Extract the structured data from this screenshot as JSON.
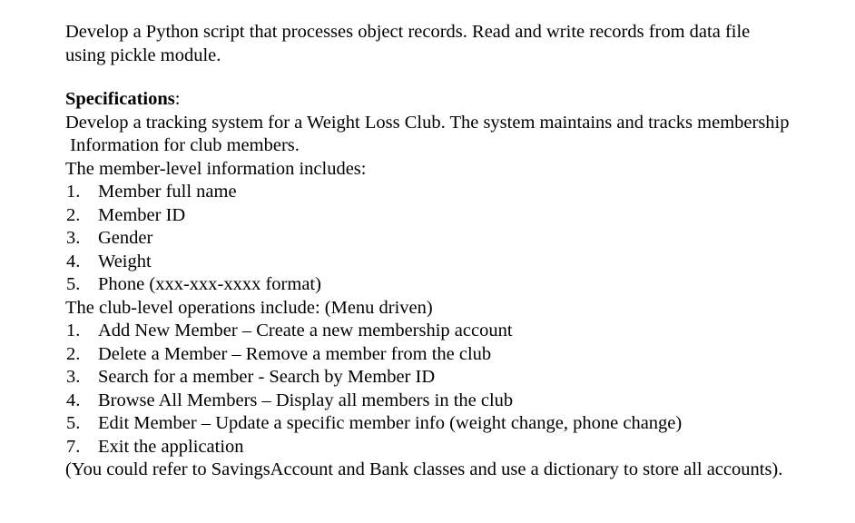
{
  "document": {
    "intro": {
      "text": "Develop a Python script that processes object records. Read and write records from data file using pickle module."
    },
    "specifications": {
      "heading": "Specifications",
      "heading_colon": ":",
      "overview_line1": "Develop a tracking system for a Weight Loss Club. The system maintains and tracks membership",
      "overview_line2": " Information for club members.",
      "member_level_header": "The member-level information includes:",
      "member_level_items": [
        {
          "number": "1.",
          "text": "Member full name"
        },
        {
          "number": "2.",
          "text": "Member ID"
        },
        {
          "number": "3.",
          "text": "Gender"
        },
        {
          "number": "4.",
          "text": "Weight"
        },
        {
          "number": "5.",
          "text": "Phone (xxx-xxx-xxxx format)"
        }
      ],
      "club_level_header": "The club-level operations include: (Menu driven)",
      "club_level_items": [
        {
          "number": "1.",
          "text": "Add New Member – Create a new membership account"
        },
        {
          "number": "2.",
          "text": "Delete a Member – Remove a member from the club"
        },
        {
          "number": "3.",
          "text": "Search for a member - Search by Member ID"
        },
        {
          "number": "4.",
          "text": "Browse All Members – Display all members in the club"
        },
        {
          "number": "5.",
          "text": "Edit Member – Update a specific member info (weight change, phone change)"
        },
        {
          "number": "7.",
          "text": "Exit the application"
        }
      ],
      "closing_note": "(You could refer to SavingsAccount and Bank classes and use a dictionary to store all accounts)."
    }
  }
}
